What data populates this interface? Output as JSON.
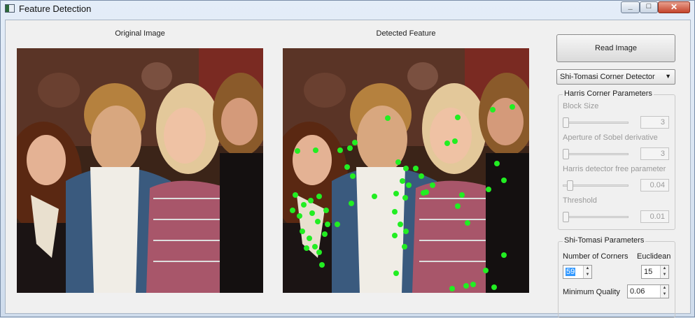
{
  "window": {
    "title": "Feature Detection"
  },
  "titlebar_buttons": {
    "minimize": "_",
    "maximize": "□",
    "close": "✕"
  },
  "captions": {
    "original": "Original Image",
    "detected": "Detected Feature"
  },
  "controls": {
    "read_button": "Read Image",
    "detector_select": {
      "selected": "Shi-Tomasi Corner Detector"
    }
  },
  "harris": {
    "title": "Harris Corner Parameters",
    "params": [
      {
        "label": "Block Size",
        "value": "3"
      },
      {
        "label": "Aperture  of  Sobel derivative",
        "value": "3"
      },
      {
        "label": "Harris detector free parameter",
        "value": "0.04"
      },
      {
        "label": "Threshold",
        "value": "0.01"
      }
    ]
  },
  "shitomasi": {
    "title": "Shi-Tomasi Parameters",
    "num_corners_label": "Number of Corners",
    "num_corners_value": "59",
    "euclidean_label": "Euclidean",
    "euclidean_value": "15",
    "min_quality_label": "Minimum Quality",
    "min_quality_value": "0.06"
  },
  "detected_corner_color": "#22ee22"
}
